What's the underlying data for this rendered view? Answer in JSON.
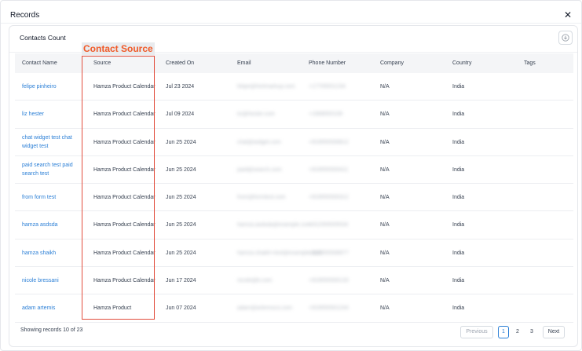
{
  "modal": {
    "title": "Records",
    "close_glyph": "✕"
  },
  "card": {
    "title": "Contacts Count",
    "action_icon": "download-icon"
  },
  "annotation": {
    "label": "Contact Source",
    "color": "#e24e3d"
  },
  "table": {
    "headers": {
      "name": "Contact Name",
      "source": "Source",
      "created": "Created On",
      "email": "Email",
      "phone": "Phone Number",
      "company": "Company",
      "country": "Country",
      "tags": "Tags"
    },
    "rows": [
      {
        "name": "felipe pinheiro",
        "source": "Hamza Product Calendar",
        "created": "Jul 23 2024",
        "email": "felipe@hintmarkup.com",
        "phone": "+17705551234",
        "company": "N/A",
        "country": "India",
        "tags": ""
      },
      {
        "name": "liz hester",
        "source": "Hamza Product Calendar",
        "created": "Jul 09 2024",
        "email": "liz@hester.com",
        "phone": "+1908555109",
        "company": "N/A",
        "country": "India",
        "tags": ""
      },
      {
        "name": "chat widget test chat widget test",
        "source": "Hamza Product Calendar",
        "created": "Jun 25 2024",
        "email": "chat@widget.com",
        "phone": "+919555506812",
        "company": "N/A",
        "country": "India",
        "tags": ""
      },
      {
        "name": "paid search test paid search test",
        "source": "Hamza Product Calendar",
        "created": "Jun 25 2024",
        "email": "paid@search.com",
        "phone": "+919555500411",
        "company": "N/A",
        "country": "India",
        "tags": ""
      },
      {
        "name": "from form test",
        "source": "Hamza Product Calendar",
        "created": "Jun 25 2024",
        "email": "from@formtest.com",
        "phone": "+919555500312",
        "company": "N/A",
        "country": "India",
        "tags": ""
      },
      {
        "name": "hamza asdsda",
        "source": "Hamza Product Calendar",
        "created": "Jun 25 2024",
        "email": "hamza.asdsda@example.com",
        "phone": "+911555505534",
        "company": "N/A",
        "country": "India",
        "tags": ""
      },
      {
        "name": "hamza shaikh",
        "source": "Hamza Product Calendar",
        "created": "Jun 25 2024",
        "email": "hamza.shaikh+test@example.com",
        "phone": "+919555508977",
        "company": "N/A",
        "country": "India",
        "tags": ""
      },
      {
        "name": "nicole bressani",
        "source": "Hamza Product Calendar",
        "created": "Jun 17 2024",
        "email": "nicole@b.com",
        "phone": "+919555500133",
        "company": "N/A",
        "country": "India",
        "tags": ""
      },
      {
        "name": "adam artemis",
        "source": "Hamza Product",
        "created": "Jun 07 2024",
        "email": "adam@artemisco.com",
        "phone": "+919555501244",
        "company": "N/A",
        "country": "India",
        "tags": ""
      }
    ]
  },
  "footer": {
    "records_text": "Showing records 10 of 23",
    "previous": "Previous",
    "pages": [
      "1",
      "2",
      "3"
    ],
    "next": "Next"
  }
}
